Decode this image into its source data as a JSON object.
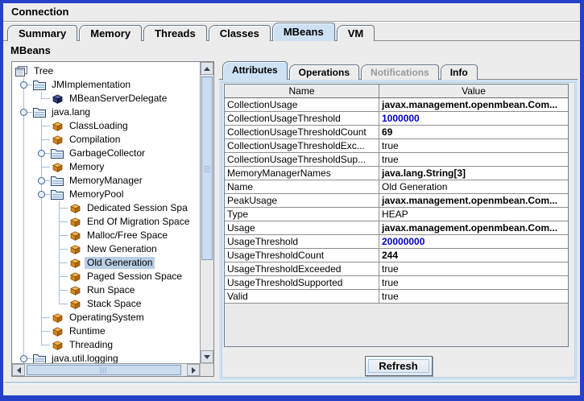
{
  "colors": {
    "window_border": "#2441c8",
    "selection": "#b8cfe5",
    "tab_selected": "#cde1f5",
    "value_blue": "#0000cc",
    "tree_line": "#a5bdd9",
    "grid_line": "#8e8e8e",
    "scroll_thumb": "#cbdcf0",
    "scroll_thumb_border": "#7e9cc0"
  },
  "menu": {
    "connection": "Connection"
  },
  "main_tabs": [
    {
      "label": "Summary",
      "selected": false
    },
    {
      "label": "Memory",
      "selected": false
    },
    {
      "label": "Threads",
      "selected": false
    },
    {
      "label": "Classes",
      "selected": false
    },
    {
      "label": "MBeans",
      "selected": true
    },
    {
      "label": "VM",
      "selected": false
    }
  ],
  "section_label": "MBeans",
  "tree": {
    "items": [
      {
        "label": "Tree",
        "icon": "root",
        "cells": [],
        "selected": false
      },
      {
        "label": "JMImplementation",
        "icon": "folder",
        "cells": [
          "toggle-exp"
        ],
        "selected": false
      },
      {
        "label": "MBeanServerDelegate",
        "icon": "bean-dark",
        "cells": [
          "v",
          "l"
        ],
        "selected": false
      },
      {
        "label": "java.lang",
        "icon": "folder",
        "cells": [
          "toggle-exp"
        ],
        "selected": false
      },
      {
        "label": "ClassLoading",
        "icon": "bean",
        "cells": [
          "v",
          "t"
        ],
        "selected": false
      },
      {
        "label": "Compilation",
        "icon": "bean",
        "cells": [
          "v",
          "t"
        ],
        "selected": false
      },
      {
        "label": "GarbageCollector",
        "icon": "folder",
        "cells": [
          "v",
          "toggle-col"
        ],
        "selected": false
      },
      {
        "label": "Memory",
        "icon": "bean",
        "cells": [
          "v",
          "t"
        ],
        "selected": false
      },
      {
        "label": "MemoryManager",
        "icon": "folder",
        "cells": [
          "v",
          "toggle-col"
        ],
        "selected": false
      },
      {
        "label": "MemoryPool",
        "icon": "folder",
        "cells": [
          "v",
          "toggle-exp"
        ],
        "selected": false
      },
      {
        "label": "Dedicated Session Spa",
        "icon": "bean",
        "cells": [
          "v",
          "v",
          "t"
        ],
        "selected": false
      },
      {
        "label": "End Of Migration Space",
        "icon": "bean",
        "cells": [
          "v",
          "v",
          "t"
        ],
        "selected": false
      },
      {
        "label": "Malloc/Free Space",
        "icon": "bean",
        "cells": [
          "v",
          "v",
          "t"
        ],
        "selected": false
      },
      {
        "label": "New Generation",
        "icon": "bean",
        "cells": [
          "v",
          "v",
          "t"
        ],
        "selected": false
      },
      {
        "label": "Old Generation",
        "icon": "bean",
        "cells": [
          "v",
          "v",
          "t"
        ],
        "selected": true
      },
      {
        "label": "Paged Session Space",
        "icon": "bean",
        "cells": [
          "v",
          "v",
          "t"
        ],
        "selected": false
      },
      {
        "label": "Run Space",
        "icon": "bean",
        "cells": [
          "v",
          "v",
          "t"
        ],
        "selected": false
      },
      {
        "label": "Stack Space",
        "icon": "bean",
        "cells": [
          "v",
          "v",
          "l"
        ],
        "selected": false
      },
      {
        "label": "OperatingSystem",
        "icon": "bean",
        "cells": [
          "v",
          "t"
        ],
        "selected": false
      },
      {
        "label": "Runtime",
        "icon": "bean",
        "cells": [
          "v",
          "t"
        ],
        "selected": false
      },
      {
        "label": "Threading",
        "icon": "bean",
        "cells": [
          "v",
          "l"
        ],
        "selected": false
      },
      {
        "label": "java.util.logging",
        "icon": "folder",
        "cells": [
          "toggle-col"
        ],
        "selected": false
      }
    ]
  },
  "detail_tabs": [
    {
      "label": "Attributes",
      "selected": true,
      "enabled": true
    },
    {
      "label": "Operations",
      "selected": false,
      "enabled": true
    },
    {
      "label": "Notifications",
      "selected": false,
      "enabled": false
    },
    {
      "label": "Info",
      "selected": false,
      "enabled": true
    }
  ],
  "table": {
    "columns": [
      "Name",
      "Value"
    ],
    "rows": [
      {
        "name": "CollectionUsage",
        "value": "javax.management.openmbean.Com...",
        "style": "bold"
      },
      {
        "name": "CollectionUsageThreshold",
        "value": "1000000",
        "style": "blue"
      },
      {
        "name": "CollectionUsageThresholdCount",
        "value": "69",
        "style": "bold"
      },
      {
        "name": "CollectionUsageThresholdExc...",
        "value": "true",
        "style": "plain"
      },
      {
        "name": "CollectionUsageThresholdSup...",
        "value": "true",
        "style": "plain"
      },
      {
        "name": "MemoryManagerNames",
        "value": "java.lang.String[3]",
        "style": "bold"
      },
      {
        "name": "Name",
        "value": "Old Generation",
        "style": "plain"
      },
      {
        "name": "PeakUsage",
        "value": "javax.management.openmbean.Com...",
        "style": "bold"
      },
      {
        "name": "Type",
        "value": "HEAP",
        "style": "plain"
      },
      {
        "name": "Usage",
        "value": "javax.management.openmbean.Com...",
        "style": "bold"
      },
      {
        "name": "UsageThreshold",
        "value": "20000000",
        "style": "blue"
      },
      {
        "name": "UsageThresholdCount",
        "value": "244",
        "style": "bold"
      },
      {
        "name": "UsageThresholdExceeded",
        "value": "true",
        "style": "plain"
      },
      {
        "name": "UsageThresholdSupported",
        "value": "true",
        "style": "plain"
      },
      {
        "name": "Valid",
        "value": "true",
        "style": "plain"
      }
    ]
  },
  "refresh_label": "Refresh"
}
